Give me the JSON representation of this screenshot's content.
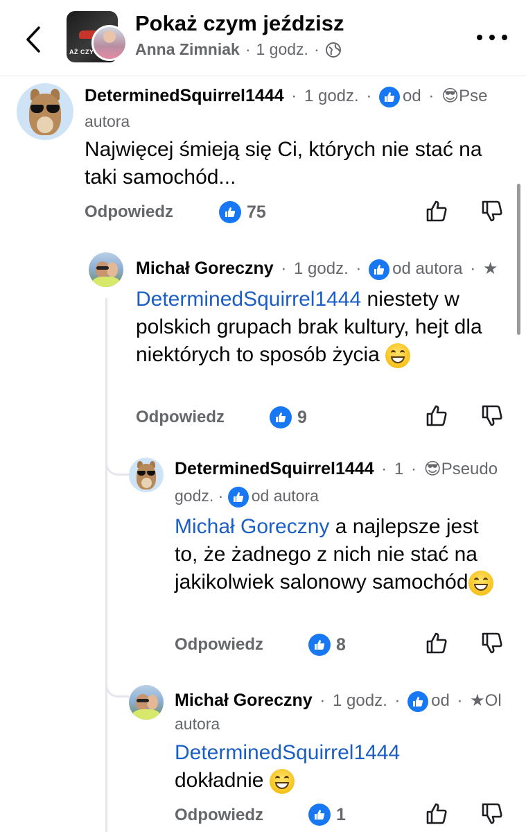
{
  "header": {
    "title": "Pokaż czym jeździsz",
    "thumb_text": "AŻ CZY",
    "author": "Anna Zimniak",
    "time": "1 godz.",
    "dot": "·",
    "back_icon": "chevron-left-icon",
    "privacy_icon": "globe-icon",
    "more_icon": "more-horizontal-icon"
  },
  "comments": [
    {
      "name": "DeterminedSquirrel1444",
      "time": "1 godz.",
      "badge_icon": "thumbs-up-icon",
      "badge_text": "od",
      "badge_text_2": "autora",
      "extra_icon": "sunglasses-icon",
      "extra_text": "Pse",
      "text": "Najwięcej śmieją się Ci, których nie stać na taki samochód...",
      "reply_label": "Odpowiedz",
      "like_count": "75"
    },
    {
      "name": "Michał Goreczny",
      "time": "1 godz.",
      "badge_text": "od autora",
      "extra_icon": "star-icon",
      "mention": "DeterminedSquirrel1444",
      "text": " niestety w polskich grupach brak kultury, hejt dla niektórych to sposób życia",
      "emoji": "grinning-face-emoji",
      "reply_label": "Odpowiedz",
      "like_count": "9"
    },
    {
      "name": "DeterminedSquirrel1444",
      "time_part1": "1",
      "time_part2": "godz.",
      "badge_text": "od autora",
      "extra_icon": "sunglasses-icon",
      "extra_text": "Pseudo",
      "mention": "Michał Goreczny",
      "text": " a najlepsze jest to, że żadnego z nich nie stać na jakikolwiek salonowy samochód",
      "emoji": "grinning-sweat-emoji",
      "reply_label": "Odpowiedz",
      "like_count": "8"
    },
    {
      "name": "Michał Goreczny",
      "time": "1 godz.",
      "badge_text": "od",
      "badge_text_2": "autora",
      "extra_icon": "star-icon",
      "extra_text": "Ol",
      "mention": "DeterminedSquirrel1444",
      "text": "dokładnie",
      "emoji": "grinning-face-emoji",
      "reply_label": "Odpowiedz",
      "like_count": "1"
    }
  ],
  "colors": {
    "accent": "#1877f2",
    "mention": "#1b5ec4",
    "secondary_text": "#65676b"
  }
}
